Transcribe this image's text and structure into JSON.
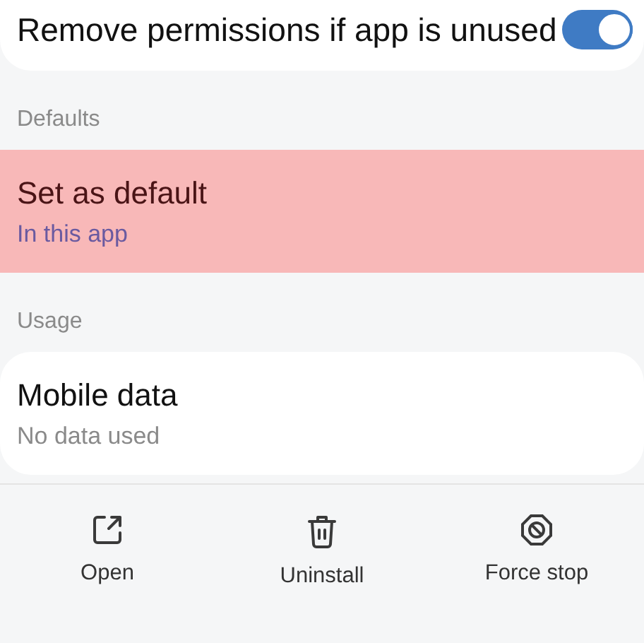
{
  "toggle_row": {
    "label": "Remove permissions if app is unused",
    "on": true
  },
  "sections": [
    {
      "header": "Defaults",
      "items": [
        {
          "title": "Set as default",
          "subtitle": "In this app",
          "highlighted": true
        }
      ]
    },
    {
      "header": "Usage",
      "items": [
        {
          "title": "Mobile data",
          "subtitle": "No data used",
          "highlighted": false
        }
      ]
    }
  ],
  "actions": [
    {
      "kind": "open",
      "label": "Open"
    },
    {
      "kind": "uninstall",
      "label": "Uninstall"
    },
    {
      "kind": "force_stop",
      "label": "Force stop"
    }
  ]
}
